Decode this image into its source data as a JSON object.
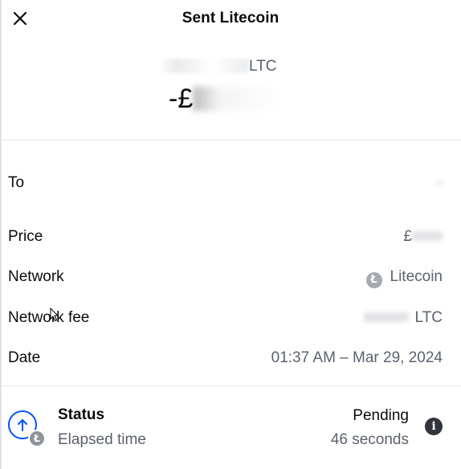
{
  "header": {
    "title": "Sent Litecoin",
    "close_icon": "close-icon"
  },
  "amount": {
    "crypto_suffix": "LTC",
    "fiat_prefix": "-£"
  },
  "details": {
    "to_label": "To",
    "price_label": "Price",
    "price_value_prefix": "£",
    "network_label": "Network",
    "network_value": "Litecoin",
    "network_icon": "litecoin-icon",
    "fee_label": "Network fee",
    "fee_suffix": "LTC",
    "date_label": "Date",
    "date_value": "01:37 AM – Mar 29, 2024"
  },
  "status": {
    "title": "Status",
    "subtitle": "Elapsed time",
    "state": "Pending",
    "elapsed": "46 seconds",
    "icon": "send-arrow-icon",
    "info_icon": "info-icon"
  },
  "colors": {
    "accent": "#0052ff",
    "text_primary": "#0a0b0d",
    "text_secondary": "#5b616e",
    "divider": "#e4e6ea"
  }
}
